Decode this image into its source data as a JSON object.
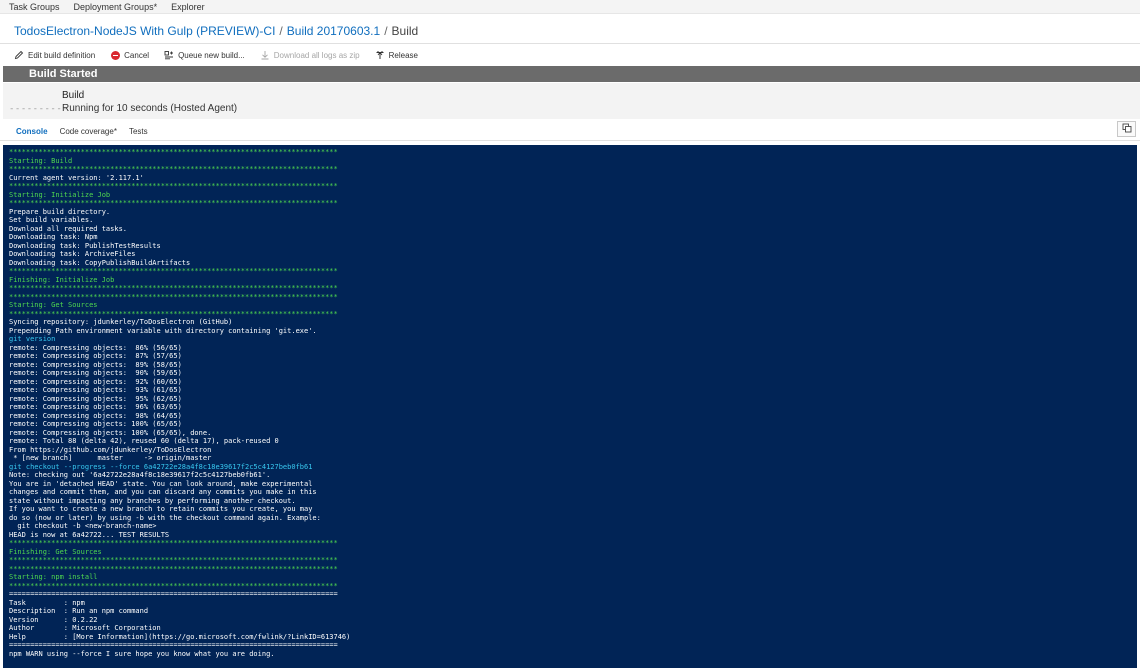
{
  "top_nav": {
    "items": [
      "Task Groups",
      "Deployment Groups*",
      "Explorer"
    ]
  },
  "breadcrumb": {
    "definition": "TodosElectron-NodeJS With Gulp (PREVIEW)-CI",
    "build": "Build 20170603.1",
    "current": "Build",
    "separator": "/"
  },
  "toolbar": {
    "edit_label": "Edit build definition",
    "cancel_label": "Cancel",
    "queue_label": "Queue new build...",
    "download_label": "Download all logs as zip",
    "release_label": "Release"
  },
  "status": {
    "title": "Build Started"
  },
  "job": {
    "name": "Build",
    "dashes": "----------",
    "status": "Running for 10 seconds (Hosted Agent)"
  },
  "tabs": {
    "console": "Console",
    "code_coverage": "Code coverage*",
    "tests": "Tests"
  },
  "icons": {
    "edit": "pencil-icon",
    "cancel": "cancel-icon",
    "queue": "queue-icon",
    "download": "download-icon",
    "release": "release-icon",
    "copy": "copy-icon"
  },
  "colors": {
    "console_bg": "#012456",
    "section_text": "#4fd84f",
    "command_text": "#38c8f0",
    "link": "#106ebe",
    "status_bar": "#6b6b6b"
  },
  "console": {
    "lines": [
      {
        "t": "******************************************************************************",
        "k": "section"
      },
      {
        "t": "Starting: Build",
        "k": "section"
      },
      {
        "t": "******************************************************************************",
        "k": "section"
      },
      {
        "t": "Current agent version: '2.117.1'",
        "k": "plain"
      },
      {
        "t": "******************************************************************************",
        "k": "section"
      },
      {
        "t": "Starting: Initialize Job",
        "k": "section"
      },
      {
        "t": "******************************************************************************",
        "k": "section"
      },
      {
        "t": "Prepare build directory.",
        "k": "plain"
      },
      {
        "t": "Set build variables.",
        "k": "plain"
      },
      {
        "t": "Download all required tasks.",
        "k": "plain"
      },
      {
        "t": "Downloading task: Npm",
        "k": "plain"
      },
      {
        "t": "Downloading task: PublishTestResults",
        "k": "plain"
      },
      {
        "t": "Downloading task: ArchiveFiles",
        "k": "plain"
      },
      {
        "t": "Downloading task: CopyPublishBuildArtifacts",
        "k": "plain"
      },
      {
        "t": "******************************************************************************",
        "k": "section"
      },
      {
        "t": "Finishing: Initialize Job",
        "k": "section"
      },
      {
        "t": "******************************************************************************",
        "k": "section"
      },
      {
        "t": "******************************************************************************",
        "k": "section"
      },
      {
        "t": "Starting: Get Sources",
        "k": "section"
      },
      {
        "t": "******************************************************************************",
        "k": "section"
      },
      {
        "t": "Syncing repository: jdunkerley/ToDosElectron (GitHub)",
        "k": "plain"
      },
      {
        "t": "Prepending Path environment variable with directory containing 'git.exe'.",
        "k": "plain"
      },
      {
        "t": "git version",
        "k": "cmd"
      },
      {
        "t": "remote: Compressing objects:  86% (56/65)",
        "k": "plain"
      },
      {
        "t": "remote: Compressing objects:  87% (57/65)",
        "k": "plain"
      },
      {
        "t": "remote: Compressing objects:  89% (58/65)",
        "k": "plain"
      },
      {
        "t": "remote: Compressing objects:  90% (59/65)",
        "k": "plain"
      },
      {
        "t": "remote: Compressing objects:  92% (60/65)",
        "k": "plain"
      },
      {
        "t": "remote: Compressing objects:  93% (61/65)",
        "k": "plain"
      },
      {
        "t": "remote: Compressing objects:  95% (62/65)",
        "k": "plain"
      },
      {
        "t": "remote: Compressing objects:  96% (63/65)",
        "k": "plain"
      },
      {
        "t": "remote: Compressing objects:  98% (64/65)",
        "k": "plain"
      },
      {
        "t": "remote: Compressing objects: 100% (65/65)",
        "k": "plain"
      },
      {
        "t": "remote: Compressing objects: 100% (65/65), done.",
        "k": "plain"
      },
      {
        "t": "remote: Total 88 (delta 42), reused 60 (delta 17), pack-reused 0",
        "k": "plain"
      },
      {
        "t": "From https://github.com/jdunkerley/ToDosElectron",
        "k": "plain"
      },
      {
        "t": " * [new branch]      master     -> origin/master",
        "k": "plain"
      },
      {
        "t": "git checkout --progress --force 6a42722e28a4f8c18e39617f2c5c4127beb0fb61",
        "k": "cmd"
      },
      {
        "t": "Note: checking out '6a42722e28a4f8c18e39617f2c5c4127beb0fb61'.",
        "k": "plain"
      },
      {
        "t": "You are in 'detached HEAD' state. You can look around, make experimental",
        "k": "plain"
      },
      {
        "t": "changes and commit them, and you can discard any commits you make in this",
        "k": "plain"
      },
      {
        "t": "state without impacting any branches by performing another checkout.",
        "k": "plain"
      },
      {
        "t": "If you want to create a new branch to retain commits you create, you may",
        "k": "plain"
      },
      {
        "t": "do so (now or later) by using -b with the checkout command again. Example:",
        "k": "plain"
      },
      {
        "t": "  git checkout -b <new-branch-name>",
        "k": "plain"
      },
      {
        "t": "HEAD is now at 6a42722... TEST RESULTS",
        "k": "plain"
      },
      {
        "t": "******************************************************************************",
        "k": "section"
      },
      {
        "t": "Finishing: Get Sources",
        "k": "section"
      },
      {
        "t": "******************************************************************************",
        "k": "section"
      },
      {
        "t": "******************************************************************************",
        "k": "section"
      },
      {
        "t": "Starting: npm install",
        "k": "section"
      },
      {
        "t": "******************************************************************************",
        "k": "section"
      },
      {
        "t": "==============================================================================",
        "k": "plain"
      },
      {
        "t": "Task         : npm",
        "k": "plain"
      },
      {
        "t": "Description  : Run an npm command",
        "k": "plain"
      },
      {
        "t": "Version      : 0.2.22",
        "k": "plain"
      },
      {
        "t": "Author       : Microsoft Corporation",
        "k": "plain"
      },
      {
        "t": "Help         : [More Information](https://go.microsoft.com/fwlink/?LinkID=613746)",
        "k": "plain"
      },
      {
        "t": "==============================================================================",
        "k": "plain"
      },
      {
        "t": "npm WARN using --force I sure hope you know what you are doing.",
        "k": "plain"
      }
    ]
  }
}
